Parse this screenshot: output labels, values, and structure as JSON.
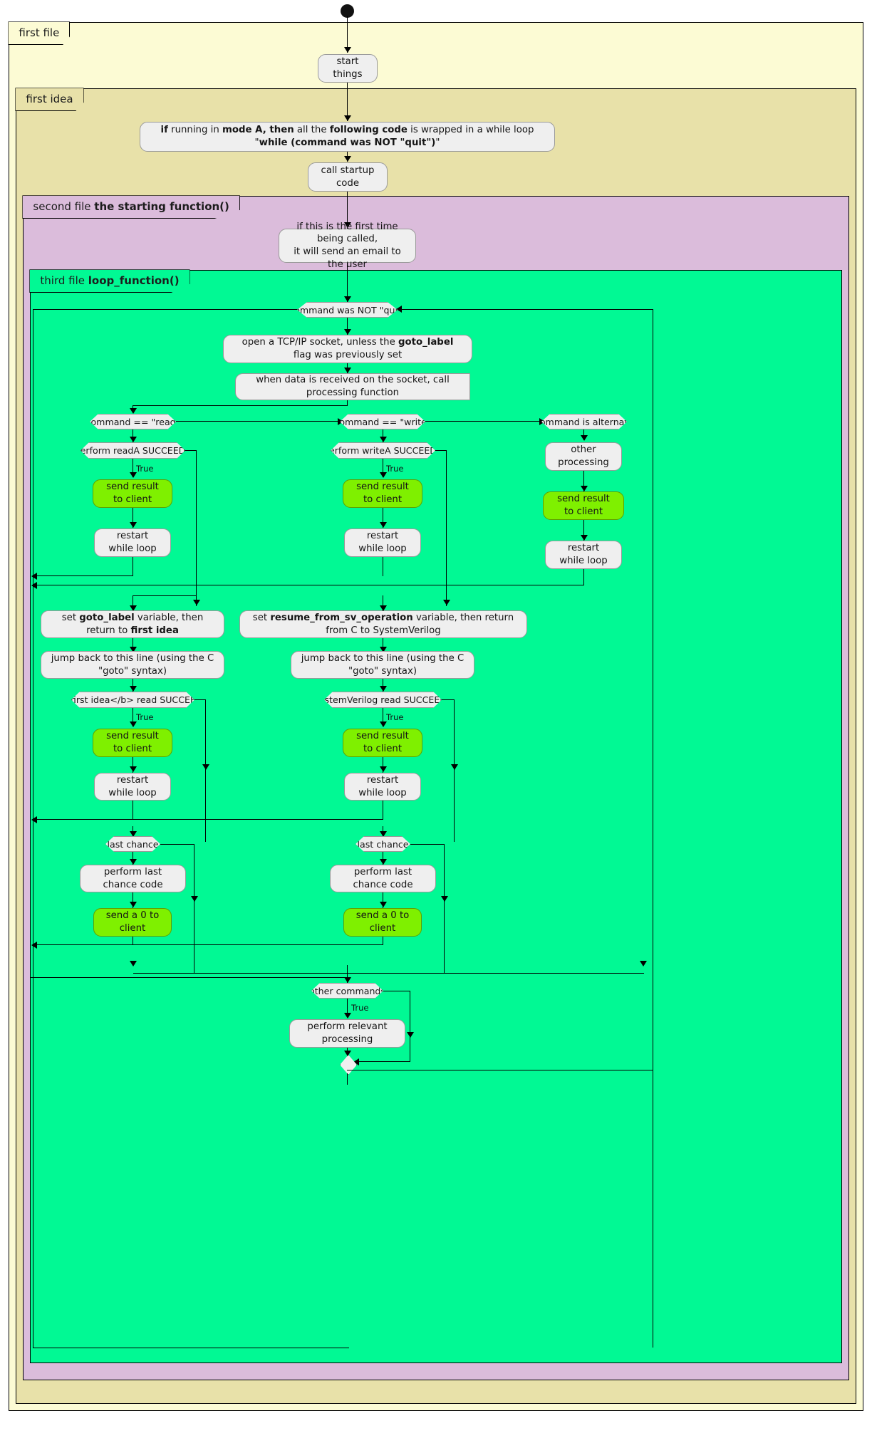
{
  "diagram": {
    "type": "plantuml-activity-diagram",
    "title": "",
    "colors": {
      "first_file_bg": "#fcfbd4",
      "first_idea_bg": "#e8e1a9",
      "second_file_bg": "#dbbcdb",
      "third_file_bg": "#01f994",
      "node_bg": "#efefef",
      "highlight_node_bg": "#7ff000",
      "line": "#000000"
    }
  },
  "partitions": {
    "first_file": {
      "label": "first file"
    },
    "first_idea": {
      "label": "first idea"
    },
    "second_file": {
      "label_plain": "second file ",
      "label_bold": "the starting function()"
    },
    "third_file": {
      "label_plain": "third file ",
      "label_bold": "loop_function()"
    }
  },
  "nodes": {
    "start_things": "start things",
    "mode_a_note": {
      "seg1_bold": "if",
      "seg2": " running in ",
      "seg3_bold": "mode A, then",
      "seg4": " all the ",
      "seg5_bold": "following code",
      "seg6": " is wrapped in a while loop \"",
      "seg7_bold": "while (command was NOT \"quit\")",
      "seg8": "\""
    },
    "call_startup_code": "call startup code",
    "first_time_email_l1": "if this is the first time being called,",
    "first_time_email_l2": "it will send an email to the user",
    "command_not_quit": "command was NOT \"quit\"",
    "open_socket": {
      "seg1": "open a TCP/IP socket, unless the ",
      "seg2_bold": "goto_label",
      "seg3": " flag was previously set"
    },
    "when_data_received": "when data is received on the socket, call processing function",
    "cmd_read": "command == \"read\"",
    "cmd_write": "command == \"write\"",
    "cmd_alternate": "command is alternate",
    "perform_readA": "perform readA SUCCEEDS",
    "perform_writeA": "perform writeA SUCCEEDS",
    "other_processing": "other processing",
    "send_result_to_client": "send result to client",
    "restart_while_loop": "restart while loop",
    "set_goto_label": {
      "seg1": "set ",
      "seg2_bold": "goto_label",
      "seg3": " variable, then return to ",
      "seg4_bold": "first idea"
    },
    "set_resume_sv": {
      "seg1": "set ",
      "seg2_bold": "resume_from_sv_operation",
      "seg3": " variable, then return from C to SystemVerilog"
    },
    "jump_back": "jump back to this line (using the C \"goto\" syntax)",
    "first_idea_read_succeeds": "<bfirst idea</b> read SUCCEEDS",
    "systemverilog_read_succeeds": "SystemVerilog read SUCCEEDS",
    "last_chance": "last chance",
    "perform_last_chance_code": "perform last chance code",
    "send_a_0_to_client": "send a 0 to client",
    "other_commands": "other commands",
    "perform_relevant_processing": "perform relevant processing"
  },
  "edge_labels": {
    "true": "True"
  }
}
